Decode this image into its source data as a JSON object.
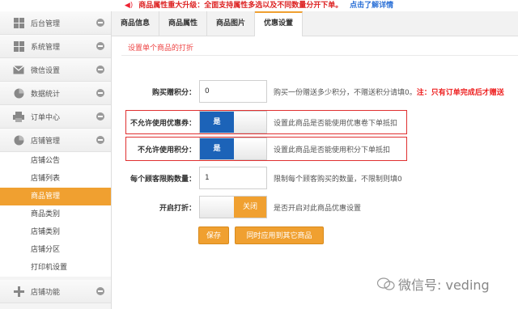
{
  "notice": {
    "text": "商品属性重大升级：全面支持属性多选以及不同数量分开下单。",
    "link": "点击了解详情"
  },
  "sidebar": {
    "items": [
      {
        "label": "后台管理",
        "icon": "grid-icon"
      },
      {
        "label": "系统管理",
        "icon": "grid-icon"
      },
      {
        "label": "微信设置",
        "icon": "envelope-icon"
      },
      {
        "label": "数据统计",
        "icon": "pie-chart-icon"
      },
      {
        "label": "订单中心",
        "icon": "printer-icon"
      },
      {
        "label": "店铺管理",
        "icon": "pie-chart-icon"
      }
    ],
    "subitems": [
      "店铺公告",
      "店铺列表",
      "商品管理",
      "商品类别",
      "店铺类别",
      "店铺分区",
      "打印机设置"
    ],
    "active_subitem": "商品管理",
    "bottom_item": {
      "label": "店铺功能",
      "icon": "plus-icon"
    }
  },
  "tabs": [
    "商品信息",
    "商品属性",
    "商品图片",
    "优惠设置"
  ],
  "active_tab": "优惠设置",
  "section_title": "设置单个商品的打折",
  "form": {
    "points": {
      "label": "购买赠积分：",
      "value": "0",
      "hint": "购买一份赠送多少积分，不赠送积分请填0。",
      "warn": "注：只有订单完成后才赠送"
    },
    "no_coupon": {
      "label": "不允许使用优惠券：",
      "state": "是",
      "hint": "设置此商品是否能使用优惠卷下单抵扣"
    },
    "no_points": {
      "label": "不允许使用积分：",
      "state": "是",
      "hint": "设置此商品是否能使用积分下单抵扣"
    },
    "limit": {
      "label": "每个顾客限购数量：",
      "value": "1",
      "hint": "限制每个顾客购买的数量，不限制则填0"
    },
    "discount": {
      "label": "开启打折：",
      "state": "关闭",
      "hint": "是否开启对此商品优惠设置"
    }
  },
  "buttons": {
    "save": "保存",
    "apply_all": "同时应用到其它商品"
  },
  "watermark": "微信号: veding",
  "colors": {
    "accent": "#f0a030",
    "toggle_on": "#1c63b8",
    "highlight": "#e03030"
  }
}
